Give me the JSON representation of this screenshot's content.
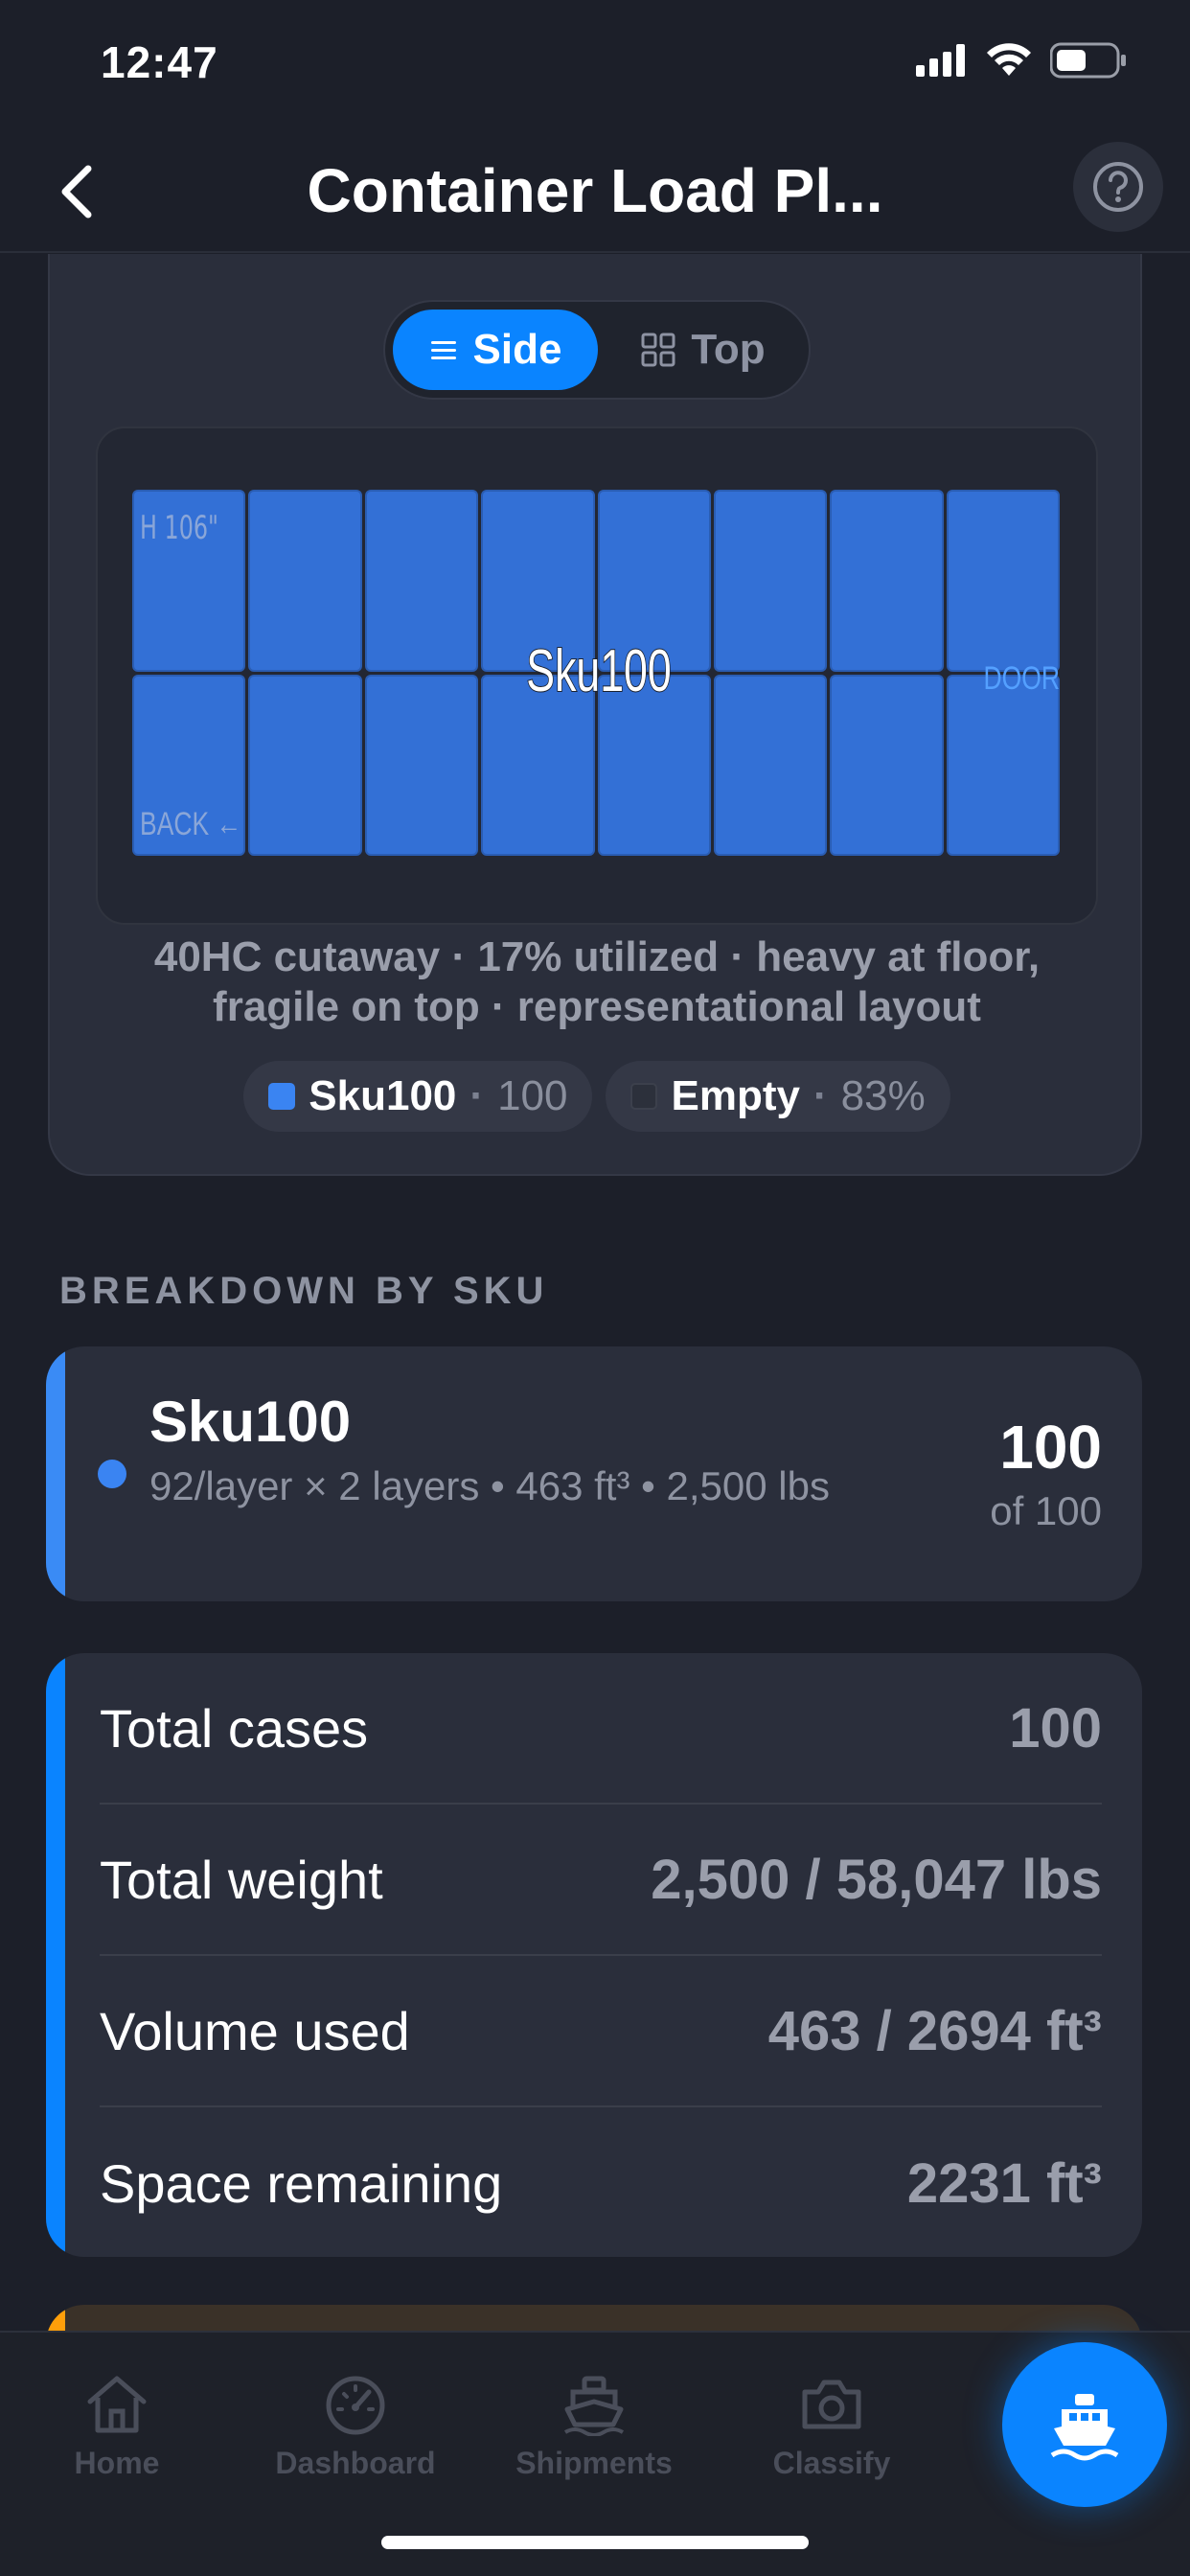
{
  "status_bar": {
    "time": "12:47"
  },
  "nav": {
    "title": "Container Load Pl..."
  },
  "view_toggle": {
    "side_label": "Side",
    "top_label": "Top",
    "selected": "Side"
  },
  "container_view": {
    "label_height": "H 106\"",
    "label_back": "BACK ←",
    "label_door": "DOOR",
    "label_sku": "Sku100",
    "caption": "40HC cutaway · 17% utilized · heavy at floor, fragile on top · representational layout",
    "legend": [
      {
        "name": "Sku100",
        "sep": "·",
        "value": "100",
        "color": "#3a84f2"
      },
      {
        "name": "Empty",
        "sep": "·",
        "value": "83%",
        "color": "#2c303b"
      }
    ]
  },
  "breakdown": {
    "section_title": "BREAKDOWN BY SKU",
    "sku": {
      "name": "Sku100",
      "detail": "92/layer × 2 layers • 463 ft³ • 2,500 lbs",
      "count": "100",
      "of": "of 100",
      "accent": "#3a8bf5"
    }
  },
  "totals": {
    "rows": [
      {
        "label": "Total cases",
        "value": "100"
      },
      {
        "label": "Total weight",
        "value": "2,500 / 58,047 lbs"
      },
      {
        "label": "Volume used",
        "value": "463 / 2694 ft³"
      },
      {
        "label": "Space remaining",
        "value": "2231 ft³"
      }
    ]
  },
  "tabbar": {
    "tabs": [
      {
        "label": "Home",
        "icon": "house-icon"
      },
      {
        "label": "Dashboard",
        "icon": "gauge-icon"
      },
      {
        "label": "Shipments",
        "icon": "ship-icon"
      },
      {
        "label": "Classify",
        "icon": "camera-icon"
      }
    ],
    "fab_icon": "ship-icon"
  }
}
